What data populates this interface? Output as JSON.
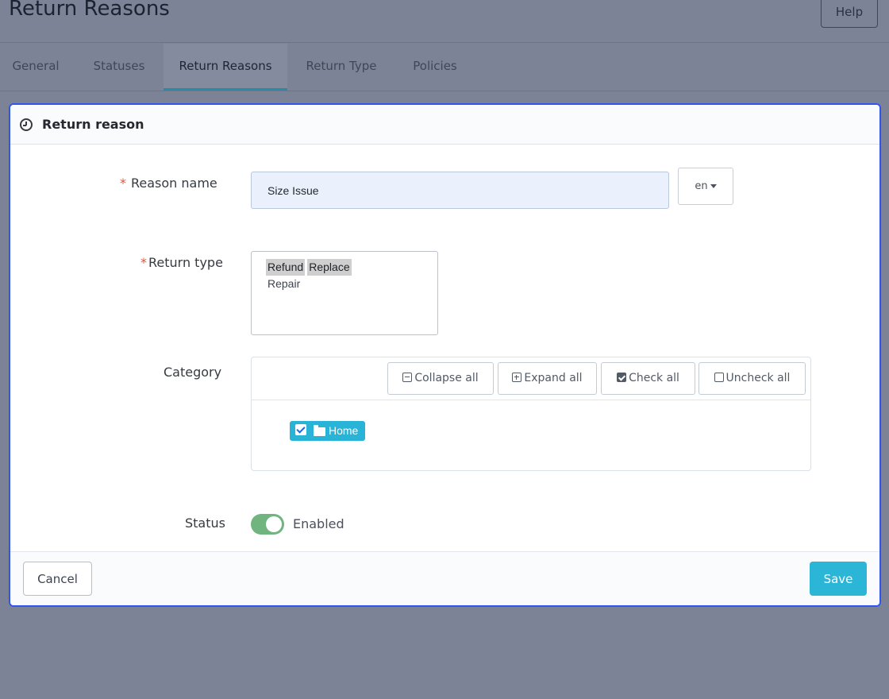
{
  "header": {
    "title": "Return Reasons",
    "help_label": "Help"
  },
  "tabs": [
    {
      "label": "General"
    },
    {
      "label": "Statuses"
    },
    {
      "label": "Return Reasons",
      "active": true
    },
    {
      "label": "Return Type"
    },
    {
      "label": "Policies"
    }
  ],
  "card": {
    "title": "Return reason",
    "header_icon": "clock-icon",
    "fields": {
      "reason_name": {
        "required_mark": "*",
        "label": "Reason name",
        "value": "Size Issue",
        "language": "en"
      },
      "return_type": {
        "required_mark": "*",
        "label": "Return type",
        "options": [
          {
            "label": "Refund",
            "selected": true
          },
          {
            "label": "Replace",
            "selected": true
          },
          {
            "label": "Repair",
            "selected": false
          }
        ]
      },
      "category": {
        "label": "Category",
        "toolbar": {
          "collapse_all": "Collapse all",
          "expand_all": "Expand all",
          "check_all": "Check all",
          "uncheck_all": "Uncheck all"
        },
        "tree": [
          {
            "label": "Home",
            "checked": true
          }
        ]
      },
      "status": {
        "label": "Status",
        "enabled": true,
        "text": "Enabled"
      }
    },
    "footer": {
      "cancel_label": "Cancel",
      "save_label": "Save"
    }
  },
  "colors": {
    "accent": "#2bb5d7",
    "focus_border": "#3155f0",
    "switch_on": "#70b580",
    "required": "#e2533c"
  }
}
